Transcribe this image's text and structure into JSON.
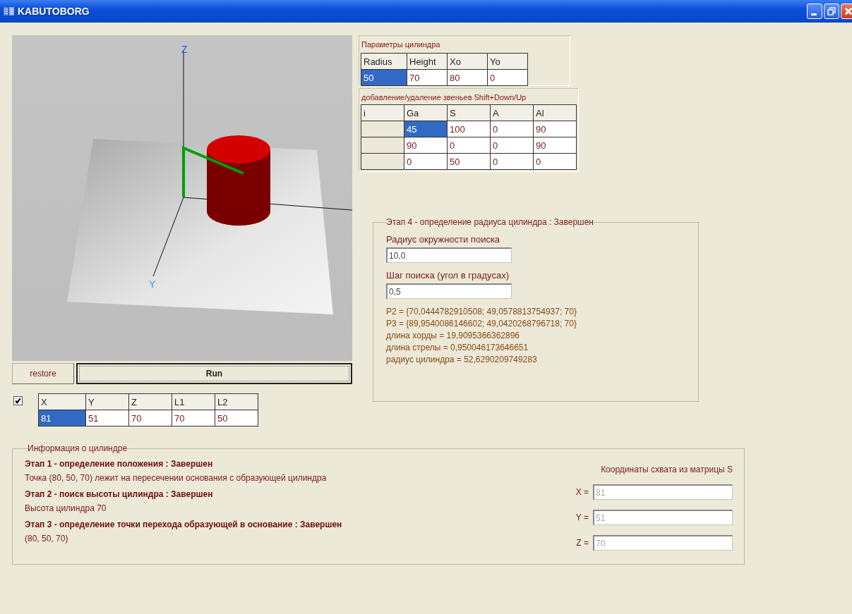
{
  "window": {
    "title": "KABUTOBORG"
  },
  "viewport": {
    "axis_labels": [
      "Z",
      "Y"
    ]
  },
  "buttons": [
    {
      "label": "restore",
      "kind": "plain"
    },
    {
      "label": "Run",
      "kind": "default"
    }
  ],
  "coords": {
    "checked": true,
    "columns": [
      "X",
      "Y",
      "Z",
      "L1",
      "L2"
    ],
    "rows": [
      [
        {
          "text": "81",
          "selected": true
        },
        {
          "text": "51",
          "selected": false
        },
        {
          "text": "70",
          "selected": false
        },
        {
          "text": "70",
          "selected": false
        },
        {
          "text": "50",
          "selected": false
        }
      ]
    ]
  },
  "cylinder_params": {
    "caption": "Параметры цилиндра",
    "columns": [
      "Radius",
      "Height",
      "Xo",
      "Yo"
    ],
    "rows": [
      [
        {
          "text": "50",
          "selected": true
        },
        {
          "text": "70",
          "selected": false
        },
        {
          "text": "80",
          "selected": false
        },
        {
          "text": "0",
          "selected": false
        }
      ]
    ]
  },
  "links": {
    "caption": "добавление/удаление звеньев Shift+Down/Up",
    "columns": [
      "i",
      "Ga",
      "S",
      "A",
      "Al"
    ],
    "rows": [
      [
        {
          "text": "",
          "selected": false
        },
        {
          "text": "45",
          "selected": true
        },
        {
          "text": "100",
          "selected": false
        },
        {
          "text": "0",
          "selected": false
        },
        {
          "text": "90",
          "selected": false
        }
      ],
      [
        {
          "text": "",
          "selected": false
        },
        {
          "text": "90",
          "selected": false
        },
        {
          "text": "0",
          "selected": false
        },
        {
          "text": "0",
          "selected": false
        },
        {
          "text": "90",
          "selected": false
        }
      ],
      [
        {
          "text": "",
          "selected": false
        },
        {
          "text": "0",
          "selected": false
        },
        {
          "text": "50",
          "selected": false
        },
        {
          "text": "0",
          "selected": false
        },
        {
          "text": "0",
          "selected": false
        }
      ]
    ]
  },
  "stage4": {
    "caption": "Этап 4 - определение радиуса цилиндра : Завершен",
    "fields": [
      {
        "label": "Радиус окружности поиска",
        "value": "10,0"
      },
      {
        "label": "Шаг поиска (угол в градусах)",
        "value": "0,5"
      }
    ],
    "results": [
      "P2 = {70,0444782910508; 49,0578813754937; 70}",
      "P3 = {89,9540086146602; 49,0420268796718; 70}",
      "длина хорды = 19,9095366362896",
      "длина стрелы = 0,950046173646651",
      "радиус цилиндра = 52,6290209749283"
    ]
  },
  "info": {
    "caption": "Информация о цилиндре",
    "stages": [
      {
        "title": "Этап 1 - определение положения : Завершен",
        "detail": "Точка (80, 50, 70) лежит на пересечении основания с образующей цилиндра"
      },
      {
        "title": "Этап 2 - поиск высоты цилиндра : Завершен",
        "detail": "Высота цилиндра 70"
      },
      {
        "title": "Этап 3 - определение точки перехода образующей в основание : Завершен",
        "detail": "(80, 50, 70)"
      }
    ],
    "grip": {
      "caption": "Координаты схвата из матрицы S",
      "fields": [
        {
          "label": "X =",
          "value": "81",
          "disabled": true
        },
        {
          "label": "Y =",
          "value": "51",
          "disabled": true
        },
        {
          "label": "Z =",
          "value": "70",
          "disabled": true
        }
      ]
    }
  }
}
